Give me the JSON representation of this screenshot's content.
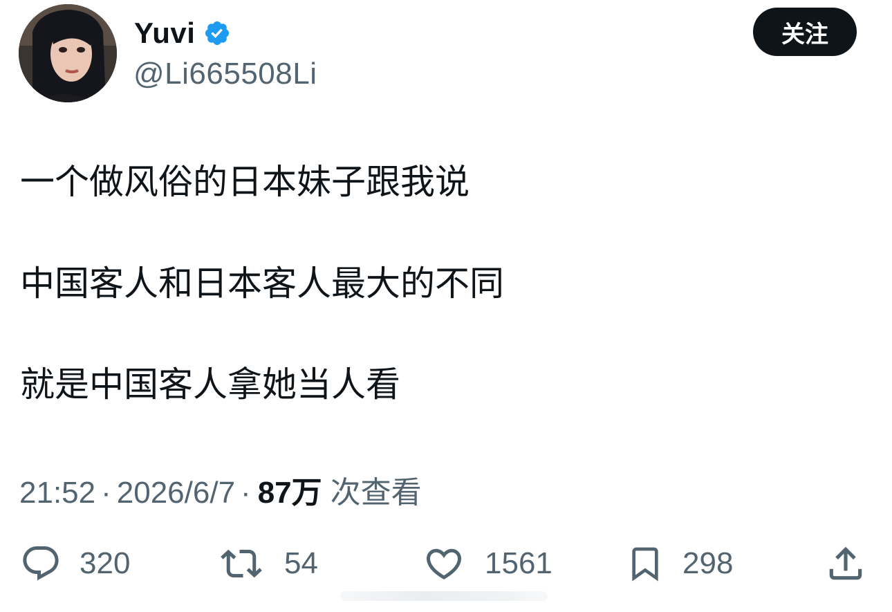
{
  "author": {
    "display_name": "Yuvi",
    "handle": "@Li665508Li",
    "verified_icon": "verified-badge-icon",
    "verified_color": "#1d9bf0"
  },
  "follow_label": "关注",
  "tweet": {
    "lines": [
      "一个做风俗的日本妹子跟我说",
      "中国客人和日本客人最大的不同",
      "就是中国客人拿她当人看"
    ]
  },
  "meta": {
    "time": "21:52",
    "separator": "·",
    "date": "2026/6/7",
    "views": "87万",
    "views_label": "次查看"
  },
  "actions": {
    "replies": "320",
    "retweets": "54",
    "likes": "1561",
    "bookmarks": "298"
  },
  "colors": {
    "text": "#0f1419",
    "secondary": "#536471",
    "button_bg": "#0f1419",
    "verified": "#1d9bf0"
  }
}
